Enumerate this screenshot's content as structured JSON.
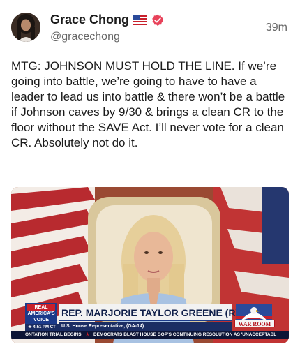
{
  "author": {
    "display_name": "Grace Chong",
    "handle": "@gracechong",
    "flag": "us-flag-icon",
    "verified": "verified-badge-icon",
    "badge_color": "#e8425a"
  },
  "post": {
    "timestamp": "39m",
    "text": "MTG: JOHNSON MUST HOLD THE LINE. If we’re going into battle, we’re going to have to have a leader to lead us into battle & there won’t be a battle if Johnson caves by 9/30 & brings a clean CR to the floor without the SAVE Act. I’ll never vote for a clean CR. Absolutely not do it."
  },
  "media": {
    "network_logo": {
      "line1": "REAL",
      "line2": "AMERICA'S",
      "line3": "VOICE"
    },
    "time": "4:51 PM CT",
    "nameplate": "REP. MARJORIE TAYLOR GREENE (R)",
    "subtitle": "U.S. House Representative, (GA-14)",
    "show_logo": "WAR ROOM",
    "ticker": {
      "item1": "ONTATION TRIAL BEGINS",
      "item2": "DEMOCRATS BLAST HOUSE GOP'S CONTINUING RESOLUTION AS 'UNACCEPTABL"
    }
  }
}
